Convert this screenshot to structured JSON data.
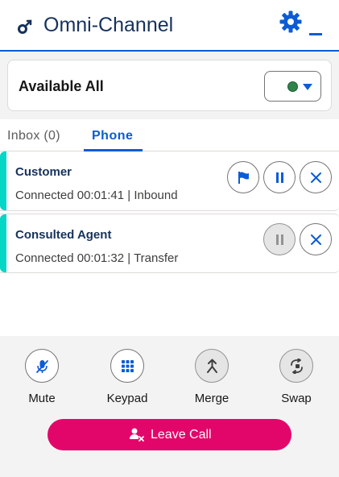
{
  "header": {
    "title": "Omni-Channel",
    "logo_icon": "omni-logo-icon",
    "settings_icon": "gear-icon",
    "minimize_icon": "minimize-icon",
    "accent_color": "#0b5cd5"
  },
  "status": {
    "label": "Available All",
    "indicator_color": "#2e844a"
  },
  "tabs": [
    {
      "label": "Inbox (0)",
      "active": false
    },
    {
      "label": "Phone",
      "active": true
    }
  ],
  "calls": [
    {
      "name": "Customer",
      "meta": "Connected 00:01:41 | Inbound",
      "actions": [
        "flag-icon",
        "pause-icon",
        "close-icon"
      ]
    },
    {
      "name": "Consulted Agent",
      "meta": "Connected 00:01:32 | Transfer",
      "actions": [
        "pause-icon",
        "close-icon"
      ]
    }
  ],
  "controls": [
    {
      "label": "Mute",
      "icon": "muted-microphone-icon"
    },
    {
      "label": "Keypad",
      "icon": "keypad-icon"
    },
    {
      "label": "Merge",
      "icon": "merge-icon"
    },
    {
      "label": "Swap",
      "icon": "swap-icon"
    }
  ],
  "leave_call": {
    "label": "Leave Call",
    "icon": "remove-user-icon",
    "color": "#e3066a"
  }
}
